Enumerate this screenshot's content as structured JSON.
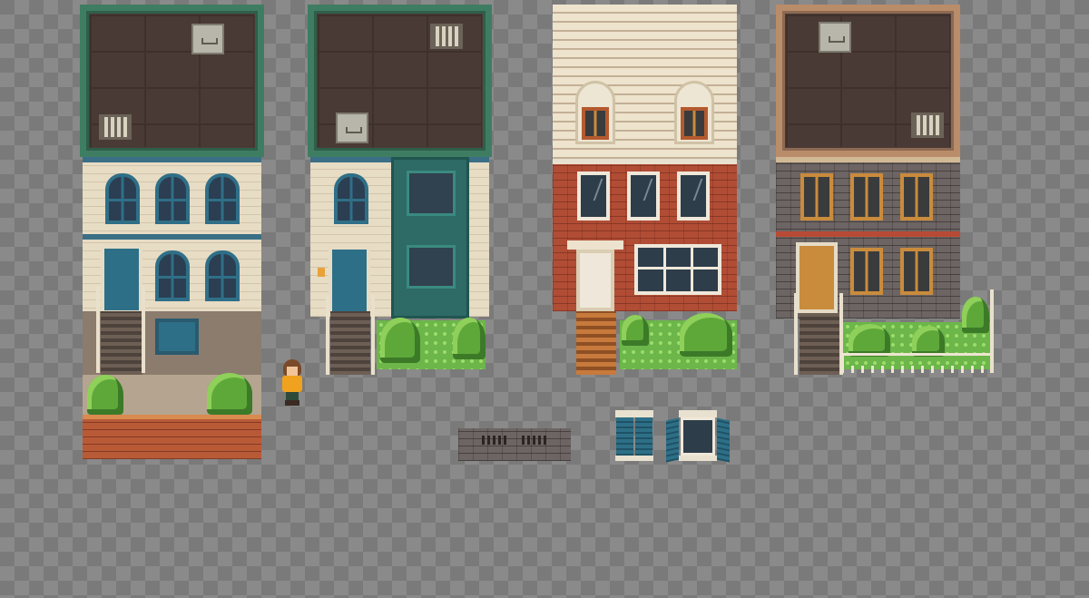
{
  "scene": {
    "title": "",
    "background": "checkerboard-transparency",
    "colors": {
      "roof_green": "#3f7d63",
      "teal_trim": "#2f6f87",
      "cream_wall": "#e7dcc4",
      "red_brick": "#b14d35",
      "grey_brick": "#6d6563",
      "wood_orange": "#c98b3c",
      "foliage": "#5ea83a"
    }
  },
  "sprites": {
    "buildings": [
      {
        "id": "townhouse-1",
        "style": "cream brick, teal arched windows, green flat roof, garden planter"
      },
      {
        "id": "townhouse-2",
        "style": "cream brick, teal bay window, green flat roof, garden"
      },
      {
        "id": "townhouse-3",
        "style": "red brick, pitched siding roof with dormers, white door"
      },
      {
        "id": "townhouse-4",
        "style": "grey brick, orange window frames, brown flat roof, fenced garden"
      }
    ],
    "character": {
      "id": "player",
      "icon": "girl-yellow-shirt"
    },
    "props": [
      {
        "id": "basement-wall"
      },
      {
        "id": "window-shutters-closed"
      },
      {
        "id": "window-shutters-open"
      }
    ]
  }
}
